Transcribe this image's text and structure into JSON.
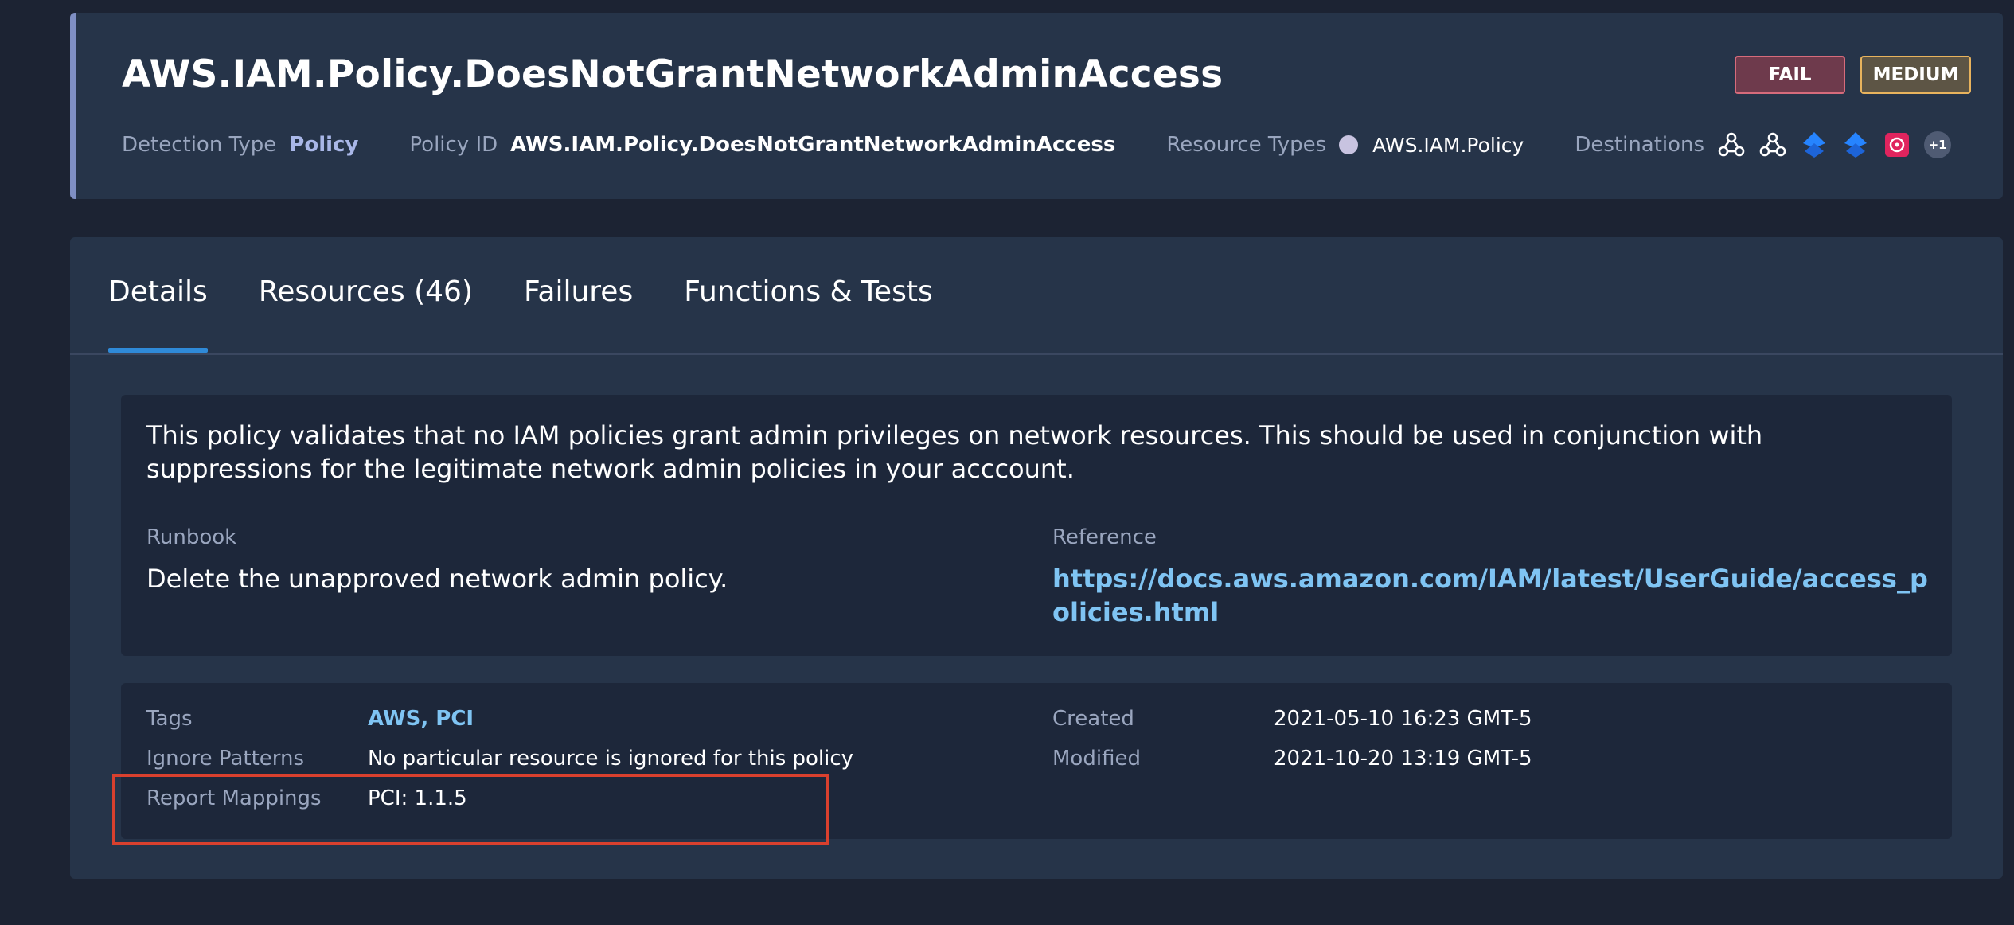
{
  "header": {
    "title": "AWS.IAM.Policy.DoesNotGrantNetworkAdminAccess",
    "status_badge": "FAIL",
    "severity_badge": "MEDIUM",
    "detection_type_label": "Detection Type",
    "detection_type_value": "Policy",
    "policy_id_label": "Policy ID",
    "policy_id_value": "AWS.IAM.Policy.DoesNotGrantNetworkAdminAccess",
    "resource_types_label": "Resource Types",
    "resource_types_value": "AWS.IAM.Policy",
    "destinations_label": "Destinations",
    "destinations_more": "+1",
    "destination_icons": [
      "webhook-icon",
      "webhook-icon",
      "jira-icon",
      "jira-icon",
      "slack-app-icon"
    ]
  },
  "tabs": [
    {
      "label": "Details",
      "active": true
    },
    {
      "label": "Resources (46)",
      "active": false
    },
    {
      "label": "Failures",
      "active": false
    },
    {
      "label": "Functions & Tests",
      "active": false
    }
  ],
  "details": {
    "description": "This policy validates that no IAM policies grant admin privileges on network resources. This should be used in conjunction with suppressions for the legitimate network admin policies in your acccount.",
    "runbook_label": "Runbook",
    "runbook_value": "Delete the unapproved network admin policy.",
    "reference_label": "Reference",
    "reference_value": "https://docs.aws.amazon.com/IAM/latest/UserGuide/access_policies.html"
  },
  "info": {
    "tags_label": "Tags",
    "tags_value": "AWS, PCI",
    "ignore_label": "Ignore Patterns",
    "ignore_value": "No particular resource is ignored for this policy",
    "report_label": "Report Mappings",
    "report_value": "PCI: 1.1.5",
    "created_label": "Created",
    "created_value": "2021-05-10 16:23 GMT-5",
    "modified_label": "Modified",
    "modified_value": "2021-10-20 13:19 GMT-5"
  },
  "colors": {
    "background": "#1c2333",
    "card": "#263449",
    "inner_card": "#1d273a",
    "fail": "#d66b7b",
    "medium": "#e8b35d",
    "link": "#7fc4f3",
    "tab_indicator": "#2f8ad8",
    "highlight": "#d9402e"
  }
}
